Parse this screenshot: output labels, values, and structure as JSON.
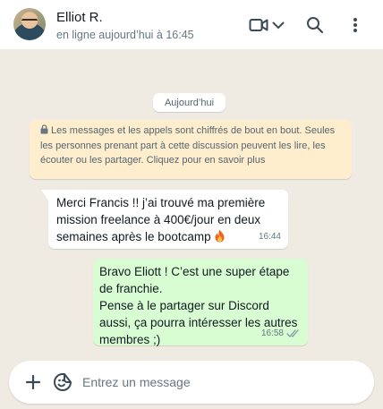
{
  "header": {
    "contact_name": "Elliot R.",
    "status": "en ligne aujourd’hui à 16:45",
    "icons": [
      "video-call-icon",
      "chevron-down-icon",
      "search-icon",
      "menu-dots-icon"
    ]
  },
  "chat": {
    "date_label": "Aujourd’hui",
    "encryption_notice": "Les messages et les appels sont chiffrés de bout en bout. Seules les personnes prenant part à cette discussion peuvent les lire, les écouter ou les partager. Cliquez pour en savoir plus",
    "messages": [
      {
        "direction": "incoming",
        "text": "Merci Francis !! j’ai trouvé ma première mission freelance à 400€/jour en deux semaines après le bootcamp",
        "emoji": "fire-icon",
        "time": "16:44"
      },
      {
        "direction": "outgoing",
        "text": "Bravo Eliott ! C’est une super étape de franchie.\nPense à le partager sur Discord aussi, ça pourra intéresser les autres membres ;)",
        "time": "16:58",
        "status_icon": "double-check-icon"
      }
    ]
  },
  "composer": {
    "placeholder": "Entrez un message",
    "value": ""
  },
  "colors": {
    "chat_background": "#efeae2",
    "incoming_bubble": "#ffffff",
    "outgoing_bubble": "#d9fdd3",
    "notice_background": "#ffeecd",
    "read_ticks": "#8696a0"
  }
}
